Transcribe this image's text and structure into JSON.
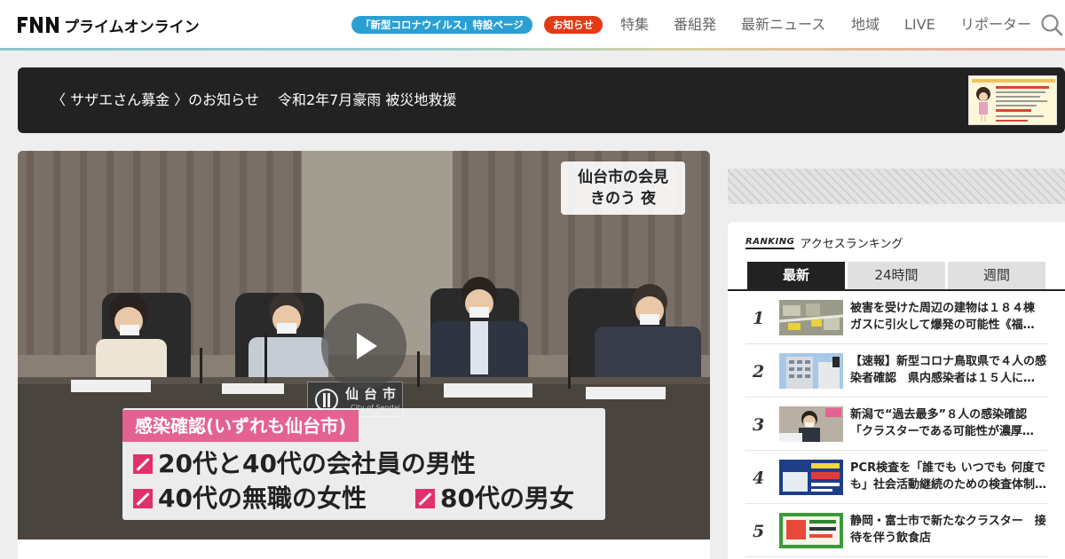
{
  "header": {
    "logo_text": "プライムオンライン",
    "corona_link": "「新型コロナウイルス」特設ページ",
    "notice_link": "お知らせ",
    "nav": [
      "特集",
      "番組発",
      "最新ニュース",
      "地域",
      "LIVE",
      "リポーター"
    ],
    "search_icon": "search-icon"
  },
  "banner": {
    "text": "〈 サザエさん募金 〉のお知らせ　 令和2年7月豪雨 被災地救援"
  },
  "video": {
    "caption_line1": "仙台市の会見",
    "caption_line2": "きのう 夜",
    "telop_heading": "感染確認(いずれも仙台市)",
    "telop_row1": "20代と40代の会社員の男性",
    "telop_row2a": "40代の無職の女性",
    "telop_row2b": "80代の男女",
    "nameplate": "仙台市",
    "nameplate_sub": "City of Sendai"
  },
  "ranking": {
    "tag": "RANKING",
    "title": "アクセスランキング",
    "tabs": [
      "最新",
      "24時間",
      "週間"
    ],
    "active_tab": "最新",
    "items": [
      {
        "rank": "1",
        "title": "被害を受けた周辺の建物は１８４棟　ガスに引火して爆発の可能性《福…"
      },
      {
        "rank": "2",
        "title": "【速報】新型コロナ鳥取県で４人の感染者確認　県内感染者は１５人に…"
      },
      {
        "rank": "3",
        "title": "新潟で“過去最多”８人の感染確認　「クラスターである可能性が濃厚…"
      },
      {
        "rank": "4",
        "title": "PCR検査を「誰でも いつでも 何度でも」社会活動継続のための検査体制…"
      },
      {
        "rank": "5",
        "title": "静岡・富士市で新たなクラスター　接待を伴う飲食店"
      }
    ]
  },
  "colors": {
    "corona_pill": "#2a9fd4",
    "notice_pill": "#e23a14",
    "telop_pink": "#e46292",
    "dark": "#222222"
  }
}
